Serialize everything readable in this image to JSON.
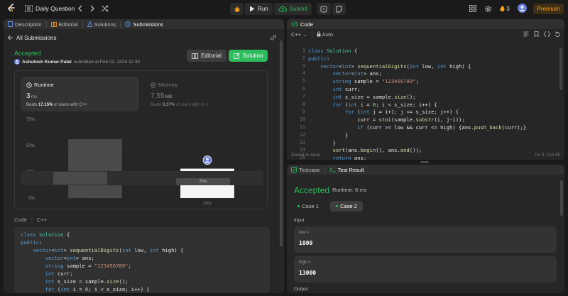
{
  "topbar": {
    "title": "Daily Question",
    "run_label": "Run",
    "submit_label": "Submit",
    "streak": "3",
    "premium_label": "Premium"
  },
  "left_tabs": [
    {
      "label": "Description",
      "active": false
    },
    {
      "label": "Editorial",
      "active": false
    },
    {
      "label": "Solutions",
      "active": false
    },
    {
      "label": "Submissions",
      "active": true
    }
  ],
  "submission": {
    "back_label": "All Submissions",
    "status": "Accepted",
    "author": "Ashutosh Kumar Patel",
    "submitted_text": "submitted at Feb 02, 2024 11:30",
    "editorial_button": "Editorial",
    "solution_button": "Solution",
    "runtime": {
      "title": "Runtime",
      "value": "3",
      "unit": "ms",
      "beats_prefix": "Beats",
      "beats_value": "17.15%",
      "beats_suffix": "of users with C++"
    },
    "memory": {
      "title": "Memory",
      "value": "7.55",
      "unit": "MB",
      "beats_prefix": "Beats",
      "beats_value": "8.37%",
      "beats_suffix": "of users with C++"
    },
    "code_label": "Code",
    "code_lang": "C++"
  },
  "chart_data": {
    "type": "bar",
    "categories": [
      "",
      "2ms"
    ],
    "values": [
      56,
      28
    ],
    "ylim": [
      0,
      75
    ],
    "yticks": [
      "0%",
      "25%",
      "50%",
      "75%"
    ],
    "xlabels": [
      "",
      "2ms"
    ],
    "mini_label": "2ms",
    "grid": true
  },
  "left_code": [
    "class Solution {",
    "public:",
    "    vector<int> sequentialDigits(int low, int high) {",
    "        vector<int> ans;",
    "        string sample = \"123456789\";",
    "        int curr;",
    "        int s_size = sample.size();",
    "        for (int i = 0; i < s_size; i++) {"
  ],
  "code_panel": {
    "tab_label": "Code",
    "language": "C++",
    "mode": "Auto",
    "saved": "Saved to local",
    "cursor": "Ln 9, Col 35",
    "lines": [
      "class Solution {",
      "public:",
      "    vector<int> sequentialDigits(int low, int high) {",
      "        vector<int> ans;",
      "        string sample = \"123456789\";",
      "        int curr;",
      "        int s_size = sample.size();",
      "        for (int i = 0; i < s_size; i++) {",
      "            for (int j = i+1; j <= s_size; j++) {",
      "                curr = stoi(sample.substr(i, j-i));",
      "                if (curr >= low && curr <= high) {ans.push_back(curr);}",
      "            }",
      "        }",
      "        sort(ans.begin(), ans.end());",
      "        return ans;"
    ]
  },
  "test_panel": {
    "testcase_tab": "Testcase",
    "result_tab": "Test Result",
    "status": "Accepted",
    "runtime": "Runtime: 6 ms",
    "cases": [
      "Case 1",
      "Case 2"
    ],
    "input_label": "Input",
    "inputs": [
      {
        "key": "low =",
        "value": "1000"
      },
      {
        "key": "high =",
        "value": "13000"
      }
    ],
    "output_label": "Output"
  }
}
